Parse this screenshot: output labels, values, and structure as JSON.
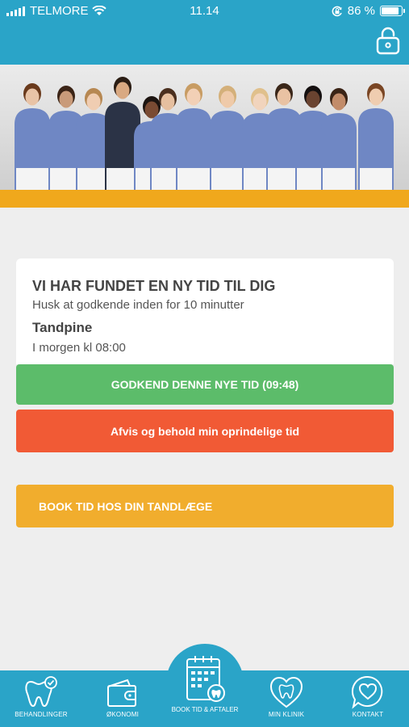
{
  "status_bar": {
    "carrier": "TELMORE",
    "time": "11.14",
    "battery": "86 %",
    "battery_level": 0.86
  },
  "header": {
    "lock_icon": "padlock-icon"
  },
  "colors": {
    "brand": "#2aa4c8",
    "accent": "#f0a81c",
    "accept": "#5cbc6a",
    "reject": "#f15a35",
    "book": "#f1ad2d"
  },
  "offer_card": {
    "title": "VI HAR FUNDET EN NY TID TIL DIG",
    "subtitle": "Husk at godkende inden for 10 minutter",
    "type": "Tandpine",
    "when": "I morgen kl 08:00"
  },
  "buttons": {
    "accept": "GODKEND DENNE NYE TID (09:48)",
    "reject": "Afvis og behold min oprindelige tid",
    "book": "BOOK TID HOS DIN TANDLÆGE"
  },
  "nav": {
    "items": [
      {
        "label": "BEHANDLINGER",
        "icon": "tooth-check-icon"
      },
      {
        "label": "ØKONOMI",
        "icon": "wallet-icon"
      },
      {
        "label": "BOOK TID & AFTALER",
        "icon": "calendar-tooth-icon"
      },
      {
        "label": "MIN KLINIK",
        "icon": "heart-tooth-icon"
      },
      {
        "label": "KONTAKT",
        "icon": "chat-heart-icon"
      }
    ]
  }
}
